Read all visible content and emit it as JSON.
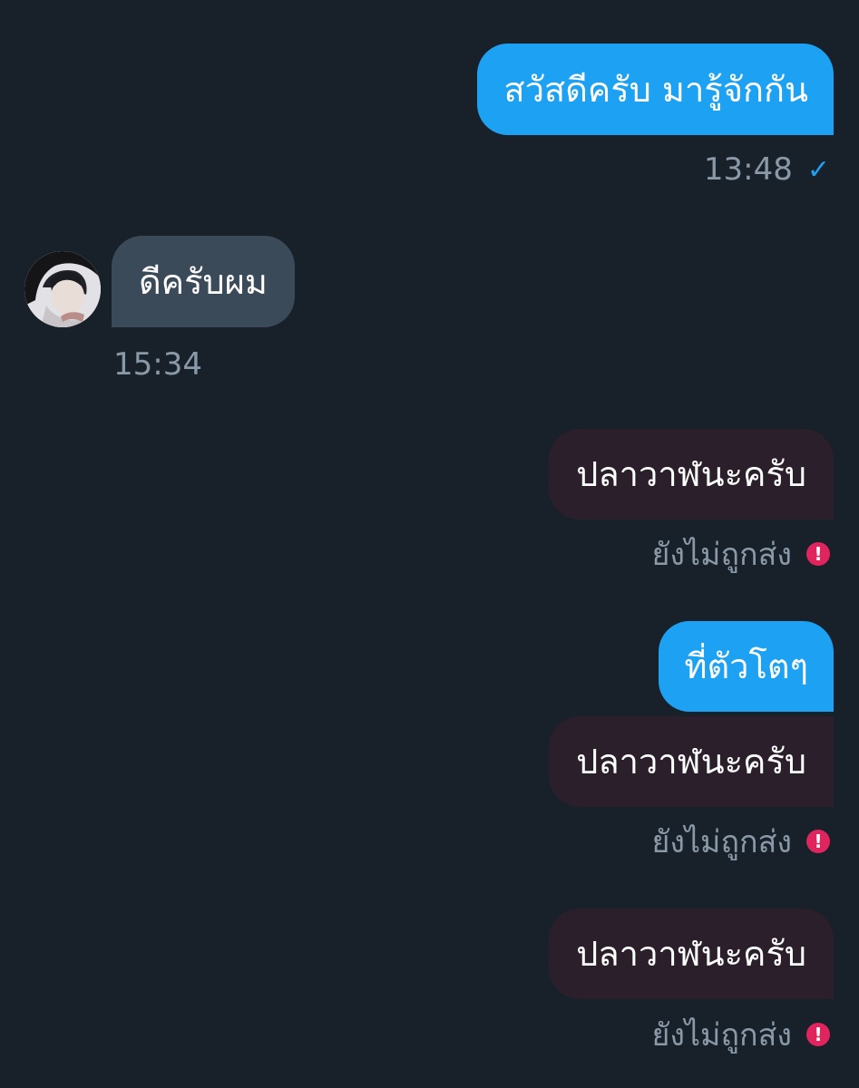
{
  "messages": [
    {
      "type": "sent",
      "text": "สวัสดีครับ มารู้จักกัน",
      "time": "13:48",
      "status_icon": "check-icon"
    },
    {
      "type": "received",
      "text": "ดีครับผม",
      "time": "15:34",
      "avatar": "profile-photo"
    },
    {
      "type": "failed",
      "text": "ปลาวาฬนะครับ",
      "status": "ยังไม่ถูกส่ง",
      "status_icon": "error-icon"
    },
    {
      "type": "sent",
      "text": "ที่ตัวโตๆ"
    },
    {
      "type": "failed",
      "text": "ปลาวาฬนะครับ",
      "status": "ยังไม่ถูกส่ง",
      "status_icon": "error-icon"
    },
    {
      "type": "failed",
      "text": "ปลาวาฬนะครับ",
      "status": "ยังไม่ถูกส่ง",
      "status_icon": "error-icon"
    }
  ],
  "icons": {
    "check": "✓",
    "error": "!"
  },
  "colors": {
    "background": "#18202a",
    "sent_bubble": "#1da1f2",
    "received_bubble": "#3b4a59",
    "failed_bubble": "#2a1f2b",
    "meta_text": "#8a99a8",
    "error_accent": "#e0245e"
  }
}
